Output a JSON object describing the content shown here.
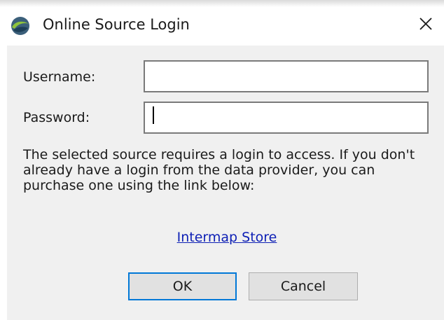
{
  "window": {
    "title": "Online Source Login",
    "app_icon": "globe-swirl-icon",
    "close_icon": "close-icon"
  },
  "form": {
    "username_label": "Username:",
    "username_value": "",
    "password_label": "Password:",
    "password_value": ""
  },
  "info": {
    "message": "The selected source requires a login to access. If you don't already have a login from the data provider, you can purchase one using the link below:",
    "link_text": "Intermap Store"
  },
  "buttons": {
    "ok_label": "OK",
    "cancel_label": "Cancel"
  },
  "colors": {
    "link": "#0d1fb5",
    "focus_border": "#0078d7",
    "client_bg": "#f0f0f0"
  }
}
